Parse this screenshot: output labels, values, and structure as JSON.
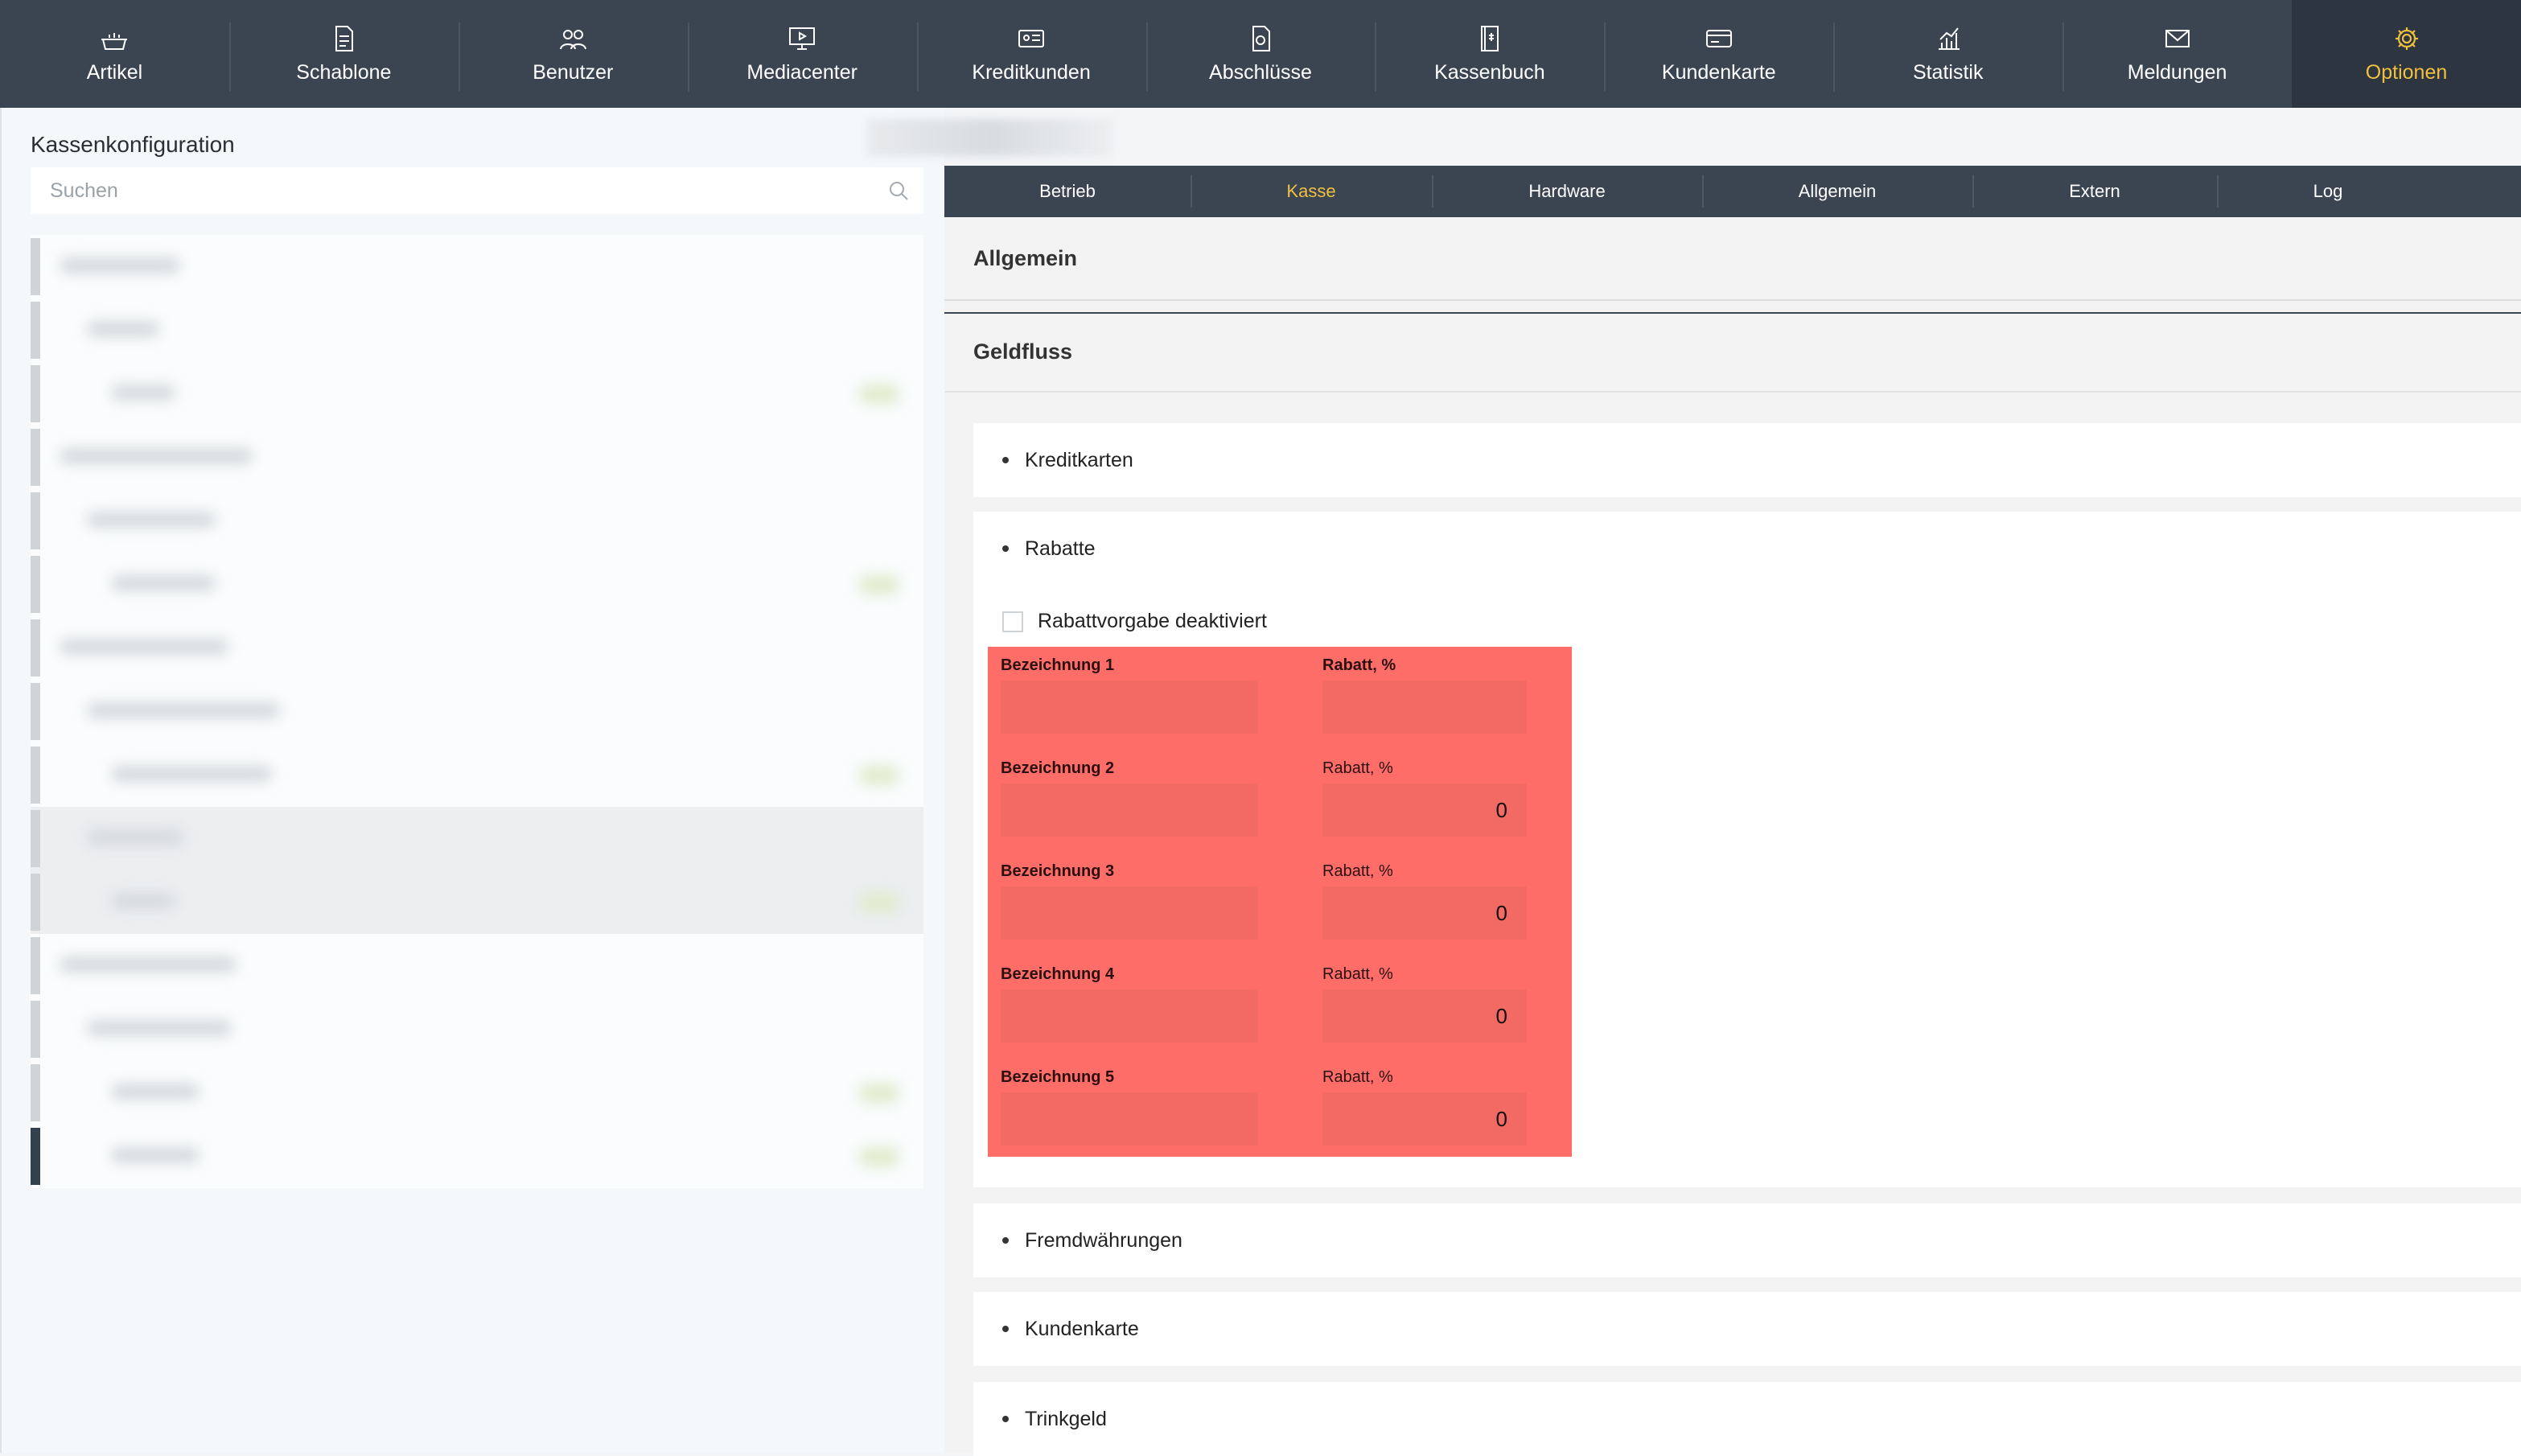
{
  "nav": {
    "items": [
      {
        "label": "Artikel",
        "icon": "basket-icon"
      },
      {
        "label": "Schablone",
        "icon": "document-icon"
      },
      {
        "label": "Benutzer",
        "icon": "users-icon"
      },
      {
        "label": "Mediacenter",
        "icon": "monitor-icon"
      },
      {
        "label": "Kreditkunden",
        "icon": "id-card-icon"
      },
      {
        "label": "Abschlüsse",
        "icon": "report-icon"
      },
      {
        "label": "Kassenbuch",
        "icon": "cashbook-icon"
      },
      {
        "label": "Kundenkarte",
        "icon": "card-icon"
      },
      {
        "label": "Statistik",
        "icon": "chart-icon"
      },
      {
        "label": "Meldungen",
        "icon": "mail-icon"
      },
      {
        "label": "Optionen",
        "icon": "gear-icon"
      }
    ],
    "active": "Optionen"
  },
  "left": {
    "title": "Kassenkonfiguration",
    "search_placeholder": "Suchen"
  },
  "subtabs": {
    "items": [
      "Betrieb",
      "Kasse",
      "Hardware",
      "Allgemein",
      "Extern",
      "Log"
    ],
    "active": "Kasse"
  },
  "sections": {
    "allgemein": "Allgemein",
    "geldfluss": "Geldfluss"
  },
  "cards": {
    "kreditkarten": "Kreditkarten",
    "rabatte": "Rabatte",
    "fremdwaehrungen": "Fremdwährungen",
    "kundenkarte": "Kundenkarte",
    "trinkgeld": "Trinkgeld"
  },
  "rabatte": {
    "checkbox_label": "Rabattvorgabe deaktiviert",
    "rows": [
      {
        "name_label": "Bezeichnung 1",
        "rate_label": "Rabatt, %",
        "name_value": "",
        "rate_value": ""
      },
      {
        "name_label": "Bezeichnung 2",
        "rate_label": "Rabatt, %",
        "name_value": "",
        "rate_value": "0"
      },
      {
        "name_label": "Bezeichnung 3",
        "rate_label": "Rabatt, %",
        "name_value": "",
        "rate_value": "0"
      },
      {
        "name_label": "Bezeichnung 4",
        "rate_label": "Rabatt, %",
        "name_value": "",
        "rate_value": "0"
      },
      {
        "name_label": "Bezeichnung 5",
        "rate_label": "Rabatt, %",
        "name_value": "",
        "rate_value": "0"
      }
    ]
  },
  "colors": {
    "nav_bg": "#3b4552",
    "accent": "#f0c040",
    "highlight": "#ff6d68"
  }
}
